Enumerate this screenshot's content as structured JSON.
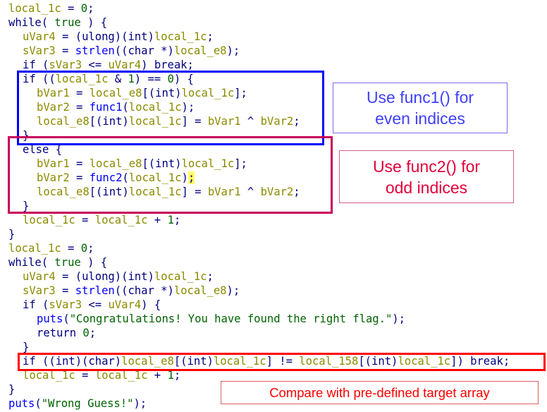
{
  "colors": {
    "keyword": "#000080",
    "variable": "#8b8b00",
    "number": "#006400",
    "string": "#006400",
    "function": "#0000ff",
    "highlight": "#ffff66",
    "even_box": "#0000ff",
    "odd_box": "#c8005a",
    "compare_box": "#ff0000"
  },
  "code_lines": [
    {
      "indent": 0,
      "tokens": [
        [
          "var",
          "local_1c"
        ],
        [
          "plain",
          " = "
        ],
        [
          "num",
          "0"
        ],
        [
          "plain",
          ";"
        ]
      ]
    },
    {
      "indent": 0,
      "tokens": [
        [
          "kw",
          "while"
        ],
        [
          "plain",
          "( "
        ],
        [
          "bool",
          "true"
        ],
        [
          "plain",
          " ) {"
        ]
      ]
    },
    {
      "indent": 1,
      "tokens": [
        [
          "var",
          "uVar4"
        ],
        [
          "plain",
          " = ("
        ],
        [
          "type",
          "ulong"
        ],
        [
          "plain",
          ")("
        ],
        [
          "type",
          "int"
        ],
        [
          "plain",
          ")"
        ],
        [
          "var",
          "local_1c"
        ],
        [
          "plain",
          ";"
        ]
      ]
    },
    {
      "indent": 1,
      "tokens": [
        [
          "var",
          "sVar3"
        ],
        [
          "plain",
          " = "
        ],
        [
          "fn",
          "strlen"
        ],
        [
          "plain",
          "(("
        ],
        [
          "type",
          "char"
        ],
        [
          "plain",
          " *)"
        ],
        [
          "var",
          "local_e8"
        ],
        [
          "plain",
          ");"
        ]
      ]
    },
    {
      "indent": 1,
      "tokens": [
        [
          "kw",
          "if"
        ],
        [
          "plain",
          " ("
        ],
        [
          "var",
          "sVar3"
        ],
        [
          "plain",
          " <= "
        ],
        [
          "var",
          "uVar4"
        ],
        [
          "plain",
          ") "
        ],
        [
          "kw",
          "break"
        ],
        [
          "plain",
          ";"
        ]
      ]
    },
    {
      "indent": 1,
      "tokens": [
        [
          "kw",
          "if"
        ],
        [
          "plain",
          " (("
        ],
        [
          "var",
          "local_1c"
        ],
        [
          "plain",
          " & "
        ],
        [
          "num",
          "1"
        ],
        [
          "plain",
          ") == "
        ],
        [
          "num",
          "0"
        ],
        [
          "plain",
          ") {"
        ]
      ]
    },
    {
      "indent": 2,
      "tokens": [
        [
          "var",
          "bVar1"
        ],
        [
          "plain",
          " = "
        ],
        [
          "var",
          "local_e8"
        ],
        [
          "plain",
          "[("
        ],
        [
          "type",
          "int"
        ],
        [
          "plain",
          ")"
        ],
        [
          "var",
          "local_1c"
        ],
        [
          "plain",
          "];"
        ]
      ]
    },
    {
      "indent": 2,
      "tokens": [
        [
          "var",
          "bVar2"
        ],
        [
          "plain",
          " = "
        ],
        [
          "fn",
          "func1"
        ],
        [
          "plain",
          "("
        ],
        [
          "var",
          "local_1c"
        ],
        [
          "plain",
          ");"
        ]
      ]
    },
    {
      "indent": 2,
      "tokens": [
        [
          "var",
          "local_e8"
        ],
        [
          "plain",
          "[("
        ],
        [
          "type",
          "int"
        ],
        [
          "plain",
          ")"
        ],
        [
          "var",
          "local_1c"
        ],
        [
          "plain",
          "] = "
        ],
        [
          "var",
          "bVar1"
        ],
        [
          "plain",
          " ^ "
        ],
        [
          "var",
          "bVar2"
        ],
        [
          "plain",
          ";"
        ]
      ]
    },
    {
      "indent": 1,
      "tokens": [
        [
          "plain",
          "}"
        ]
      ]
    },
    {
      "indent": 1,
      "tokens": [
        [
          "kw",
          "else"
        ],
        [
          "plain",
          " {"
        ]
      ]
    },
    {
      "indent": 2,
      "tokens": [
        [
          "var",
          "bVar1"
        ],
        [
          "plain",
          " = "
        ],
        [
          "var",
          "local_e8"
        ],
        [
          "plain",
          "[("
        ],
        [
          "type",
          "int"
        ],
        [
          "plain",
          ")"
        ],
        [
          "var",
          "local_1c"
        ],
        [
          "plain",
          "];"
        ]
      ]
    },
    {
      "indent": 2,
      "tokens": [
        [
          "var",
          "bVar2"
        ],
        [
          "plain",
          " = "
        ],
        [
          "fn",
          "func2"
        ],
        [
          "plain",
          "("
        ],
        [
          "var",
          "local_1c"
        ],
        [
          "plain",
          ")"
        ],
        [
          "hl",
          ";"
        ]
      ]
    },
    {
      "indent": 2,
      "tokens": [
        [
          "var",
          "local_e8"
        ],
        [
          "plain",
          "[("
        ],
        [
          "type",
          "int"
        ],
        [
          "plain",
          ")"
        ],
        [
          "var",
          "local_1c"
        ],
        [
          "plain",
          "] = "
        ],
        [
          "var",
          "bVar1"
        ],
        [
          "plain",
          " ^ "
        ],
        [
          "var",
          "bVar2"
        ],
        [
          "plain",
          ";"
        ]
      ]
    },
    {
      "indent": 1,
      "tokens": [
        [
          "plain",
          "}"
        ]
      ]
    },
    {
      "indent": 1,
      "tokens": [
        [
          "var",
          "local_1c"
        ],
        [
          "plain",
          " = "
        ],
        [
          "var",
          "local_1c"
        ],
        [
          "plain",
          " + "
        ],
        [
          "num",
          "1"
        ],
        [
          "plain",
          ";"
        ]
      ]
    },
    {
      "indent": 0,
      "tokens": [
        [
          "plain",
          "}"
        ]
      ]
    },
    {
      "indent": 0,
      "tokens": [
        [
          "var",
          "local_1c"
        ],
        [
          "plain",
          " = "
        ],
        [
          "num",
          "0"
        ],
        [
          "plain",
          ";"
        ]
      ]
    },
    {
      "indent": 0,
      "tokens": [
        [
          "kw",
          "while"
        ],
        [
          "plain",
          "( "
        ],
        [
          "bool",
          "true"
        ],
        [
          "plain",
          " ) {"
        ]
      ]
    },
    {
      "indent": 1,
      "tokens": [
        [
          "var",
          "uVar4"
        ],
        [
          "plain",
          " = ("
        ],
        [
          "type",
          "ulong"
        ],
        [
          "plain",
          ")("
        ],
        [
          "type",
          "int"
        ],
        [
          "plain",
          ")"
        ],
        [
          "var",
          "local_1c"
        ],
        [
          "plain",
          ";"
        ]
      ]
    },
    {
      "indent": 1,
      "tokens": [
        [
          "var",
          "sVar3"
        ],
        [
          "plain",
          " = "
        ],
        [
          "fn",
          "strlen"
        ],
        [
          "plain",
          "(("
        ],
        [
          "type",
          "char"
        ],
        [
          "plain",
          " *)"
        ],
        [
          "var",
          "local_e8"
        ],
        [
          "plain",
          ");"
        ]
      ]
    },
    {
      "indent": 1,
      "tokens": [
        [
          "kw",
          "if"
        ],
        [
          "plain",
          " ("
        ],
        [
          "var",
          "sVar3"
        ],
        [
          "plain",
          " <= "
        ],
        [
          "var",
          "uVar4"
        ],
        [
          "plain",
          ") {"
        ]
      ]
    },
    {
      "indent": 2,
      "tokens": [
        [
          "fn",
          "puts"
        ],
        [
          "plain",
          "("
        ],
        [
          "str",
          "\"Congratulations! You have found the right flag.\""
        ],
        [
          "plain",
          ");"
        ]
      ]
    },
    {
      "indent": 2,
      "tokens": [
        [
          "kw",
          "return"
        ],
        [
          "plain",
          " "
        ],
        [
          "num",
          "0"
        ],
        [
          "plain",
          ";"
        ]
      ]
    },
    {
      "indent": 1,
      "tokens": [
        [
          "plain",
          "}"
        ]
      ]
    },
    {
      "indent": 1,
      "tokens": [
        [
          "kw",
          "if"
        ],
        [
          "plain",
          " (("
        ],
        [
          "type",
          "int"
        ],
        [
          "plain",
          ")("
        ],
        [
          "type",
          "char"
        ],
        [
          "plain",
          ")"
        ],
        [
          "var",
          "local_e8"
        ],
        [
          "plain",
          "[("
        ],
        [
          "type",
          "int"
        ],
        [
          "plain",
          ")"
        ],
        [
          "var",
          "local_1c"
        ],
        [
          "plain",
          "] != "
        ],
        [
          "var",
          "local_158"
        ],
        [
          "plain",
          "[("
        ],
        [
          "type",
          "int"
        ],
        [
          "plain",
          ")"
        ],
        [
          "var",
          "local_1c"
        ],
        [
          "plain",
          "]) "
        ],
        [
          "kw",
          "break"
        ],
        [
          "plain",
          ";"
        ]
      ]
    },
    {
      "indent": 1,
      "tokens": [
        [
          "var",
          "local_1c"
        ],
        [
          "plain",
          " = "
        ],
        [
          "var",
          "local_1c"
        ],
        [
          "plain",
          " + "
        ],
        [
          "num",
          "1"
        ],
        [
          "plain",
          ";"
        ]
      ]
    },
    {
      "indent": 0,
      "tokens": [
        [
          "plain",
          "}"
        ]
      ]
    },
    {
      "indent": 0,
      "tokens": [
        [
          "fn",
          "puts"
        ],
        [
          "plain",
          "("
        ],
        [
          "str",
          "\"Wrong Guess!\""
        ],
        [
          "plain",
          ");"
        ]
      ]
    }
  ],
  "annotations": {
    "even": {
      "line1": "Use func1() for",
      "line2": "even indices"
    },
    "odd": {
      "line1": "Use func2() for",
      "line2": "odd indices"
    },
    "compare": {
      "line1": "Compare with pre-defined target array"
    }
  }
}
